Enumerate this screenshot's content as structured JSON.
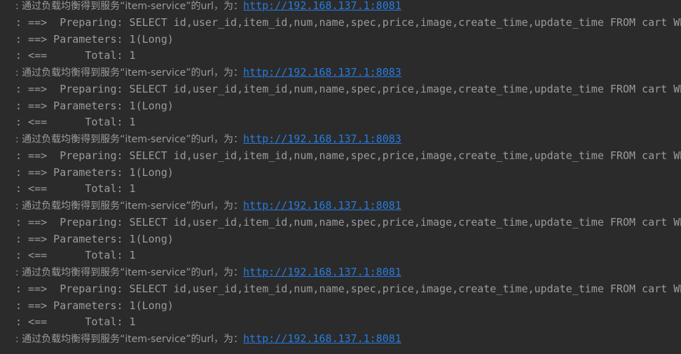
{
  "colors": {
    "background": "#2b2b2b",
    "text": "#9a9b9d",
    "link": "#287bde"
  },
  "lines": [
    {
      "type": "lb",
      "prefix": ": 通过负载均衡得到服务“item-service”的url，为：",
      "url": "http://192.168.137.1:8081"
    },
    {
      "type": "text",
      "text": ": ==>  Preparing: SELECT id,user_id,item_id,num,name,spec,price,image,create_time,update_time FROM cart WH"
    },
    {
      "type": "text",
      "text": ": ==> Parameters: 1(Long)"
    },
    {
      "type": "text",
      "text": ": <==      Total: 1"
    },
    {
      "type": "lb",
      "prefix": ": 通过负载均衡得到服务“item-service”的url，为：",
      "url": "http://192.168.137.1:8083"
    },
    {
      "type": "text",
      "text": ": ==>  Preparing: SELECT id,user_id,item_id,num,name,spec,price,image,create_time,update_time FROM cart WH"
    },
    {
      "type": "text",
      "text": ": ==> Parameters: 1(Long)"
    },
    {
      "type": "text",
      "text": ": <==      Total: 1"
    },
    {
      "type": "lb",
      "prefix": ": 通过负载均衡得到服务“item-service”的url，为：",
      "url": "http://192.168.137.1:8083"
    },
    {
      "type": "text",
      "text": ": ==>  Preparing: SELECT id,user_id,item_id,num,name,spec,price,image,create_time,update_time FROM cart WH"
    },
    {
      "type": "text",
      "text": ": ==> Parameters: 1(Long)"
    },
    {
      "type": "text",
      "text": ": <==      Total: 1"
    },
    {
      "type": "lb",
      "prefix": ": 通过负载均衡得到服务“item-service”的url，为：",
      "url": "http://192.168.137.1:8081"
    },
    {
      "type": "text",
      "text": ": ==>  Preparing: SELECT id,user_id,item_id,num,name,spec,price,image,create_time,update_time FROM cart WH"
    },
    {
      "type": "text",
      "text": ": ==> Parameters: 1(Long)"
    },
    {
      "type": "text",
      "text": ": <==      Total: 1"
    },
    {
      "type": "lb",
      "prefix": ": 通过负载均衡得到服务“item-service”的url，为：",
      "url": "http://192.168.137.1:8081"
    },
    {
      "type": "text",
      "text": ": ==>  Preparing: SELECT id,user_id,item_id,num,name,spec,price,image,create_time,update_time FROM cart WH"
    },
    {
      "type": "text",
      "text": ": ==> Parameters: 1(Long)"
    },
    {
      "type": "text",
      "text": ": <==      Total: 1"
    },
    {
      "type": "lb",
      "prefix": ": 通过负载均衡得到服务“item-service”的url，为：",
      "url": "http://192.168.137.1:8081"
    }
  ]
}
